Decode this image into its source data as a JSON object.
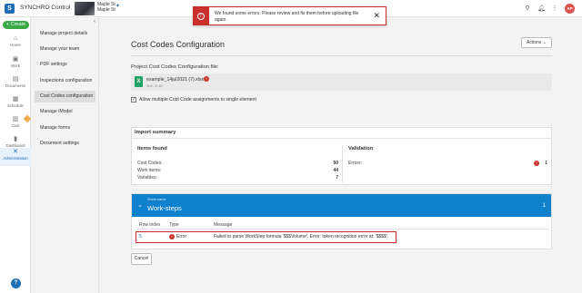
{
  "app": {
    "logo_letter": "S",
    "name": "SYNCHRO Control"
  },
  "project": {
    "line1": "Maple St",
    "line2": "Maple St",
    "pin_icon": "pin-icon"
  },
  "topbar": {
    "location_icon": "location-icon",
    "bell_icon": "bell-icon",
    "apps_icon": "apps-grid-icon",
    "avatar_initials": "AP",
    "avatar_color": "#d9534f"
  },
  "toast": {
    "message": "We found some errors. Please review and fix them before uploading file again.",
    "close": "✕",
    "color": "#c9302c"
  },
  "rail": {
    "create_label": "+ Create",
    "items": [
      {
        "label": "Home",
        "icon": "home-icon"
      },
      {
        "label": "Work",
        "icon": "work-icon"
      },
      {
        "label": "Documents",
        "icon": "documents-icon"
      },
      {
        "label": "Schedule",
        "icon": "schedule-icon"
      },
      {
        "label": "Cost",
        "icon": "cost-icon"
      },
      {
        "label": "Dashboard",
        "icon": "dashboard-icon"
      },
      {
        "label": "Administration",
        "icon": "administration-icon"
      }
    ],
    "help": "?"
  },
  "nav": {
    "collapse": "‹",
    "items": [
      "Manage project details",
      "Manage your team",
      "PDF settings",
      "Inspections configuration",
      "Cost Codes configuration",
      "Manage iModel",
      "Manage forms",
      "Document settings"
    ]
  },
  "main": {
    "title": "Cost Codes Configuration",
    "actions_label": "Actions  ⌄",
    "file_label": "Project Cost Codes Configuration file:",
    "file": {
      "icon_letter": "X",
      "name": "example_14jul2021 (7).xlsx",
      "size": "Size: 41 kB",
      "error_mark": "!"
    },
    "allow_multiple": {
      "checked": "✓",
      "label": "Allow multiple Cost Code assignments to single element"
    },
    "summary": {
      "title": "Import summary",
      "items_found_title": "Items found",
      "items": [
        {
          "label": "Cost Codes:",
          "value": "50"
        },
        {
          "label": "Work items:",
          "value": "44"
        },
        {
          "label": "Variables:",
          "value": "7"
        }
      ],
      "validation_title": "Validation",
      "errors_label": "Errors:",
      "errors_mark": "!",
      "errors_value": "1"
    },
    "sheet": {
      "chevron": "⌄",
      "subtitle": "Sheet name",
      "name": "Work-steps",
      "count": "1",
      "headers": [
        "Row index",
        "Type",
        "Message"
      ],
      "row": {
        "index": "5",
        "type_mark": "!",
        "type": "Error",
        "message": "Failed to parse WorkStep formula '$$$Volume'. Error: token recognition error at: '$$$$'."
      }
    },
    "cancel_label": "Cancel"
  }
}
